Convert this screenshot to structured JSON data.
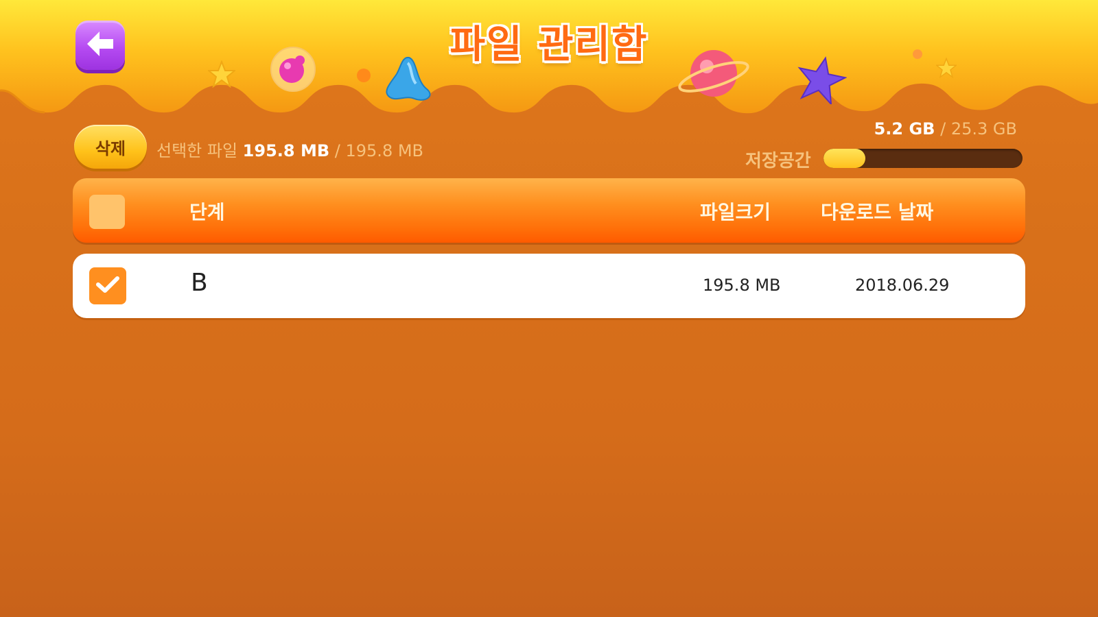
{
  "header": {
    "title": "파일 관리함",
    "back_icon": "arrow-left-icon"
  },
  "toolbar": {
    "delete_label": "삭제",
    "selected_label": "선택한 파일",
    "selected_size": "195.8 MB",
    "separator": "/",
    "total_size": "195.8 MB"
  },
  "storage": {
    "used": "5.2 GB",
    "separator": "/",
    "total": "25.3 GB",
    "label": "저장공간",
    "used_fraction": 0.21
  },
  "table": {
    "columns": [
      "단계",
      "파일크기",
      "다운로드 날짜"
    ],
    "rows": [
      {
        "name": "B",
        "size": "195.8 MB",
        "date": "2018.06.29",
        "checked": true
      }
    ]
  },
  "colors": {
    "accent": "#ff8f1f",
    "back_button": "#b64bf2",
    "background": "#d8701a",
    "storage_fill": "#ffc11d"
  }
}
